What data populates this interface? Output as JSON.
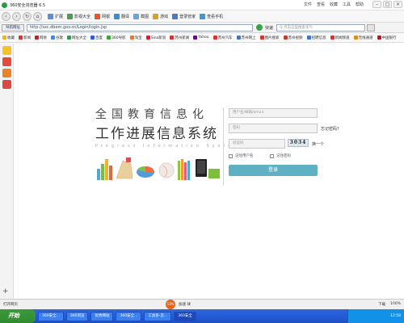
{
  "window": {
    "title": "360安全浏览器 6.5",
    "menus": [
      "文件",
      "查看",
      "收藏",
      "工具",
      "帮助"
    ]
  },
  "toolbar": {
    "buttons": [
      "扩展",
      "影视大全",
      "网银",
      "翻译",
      "截图",
      "游戏",
      "登录管家",
      "查看手机"
    ],
    "search_label": "搜索"
  },
  "address": {
    "home_label": "导航网址",
    "url": "http://sxc.dbem.gov.cn/Login/login.jsp",
    "go_label": "快速",
    "search_placeholder": "Q 点击这里搜索天气"
  },
  "favorites": [
    "收藏",
    "新闻",
    "网易",
    "谷歌",
    "网址大全",
    "百度",
    "360导航",
    "淘宝",
    "Sina新浪",
    "苏州新闻",
    "Yahoo",
    "苏州汽车",
    "苏州网上",
    "图片搜索",
    "苏州视频",
    "招聘信息",
    "新闻频道",
    "无线通道",
    "中国银行"
  ],
  "content": {
    "brand_top": "全国教育信息化",
    "brand_main": "工作进展信息系统",
    "brand_en": "Progress Information System",
    "login": {
      "username_placeholder": "用户名/邮箱/email",
      "password_placeholder": "密码",
      "forgot_label": "忘记密码?",
      "captcha_placeholder": "验证码",
      "captcha_value": "3034",
      "refresh_label": "换一个",
      "remember_label": "记住用户名",
      "remember_password_label": "记住密码",
      "submit_label": "登录"
    }
  },
  "statusbar": {
    "left": "打开网页",
    "center_ball": "53%",
    "center_text": "加速\n球",
    "right": [
      "下载",
      "100%"
    ]
  },
  "taskbar": {
    "start_label": "开始",
    "tasks": [
      "360安全...",
      "360浏览",
      "优秀网站",
      "360安全...",
      "工具条-云...",
      "360安全"
    ],
    "tray_time": "12:58"
  },
  "colors": {
    "login_button": "#5eb0c2",
    "taskbar": "#245edb",
    "start": "#2e8b2e"
  }
}
